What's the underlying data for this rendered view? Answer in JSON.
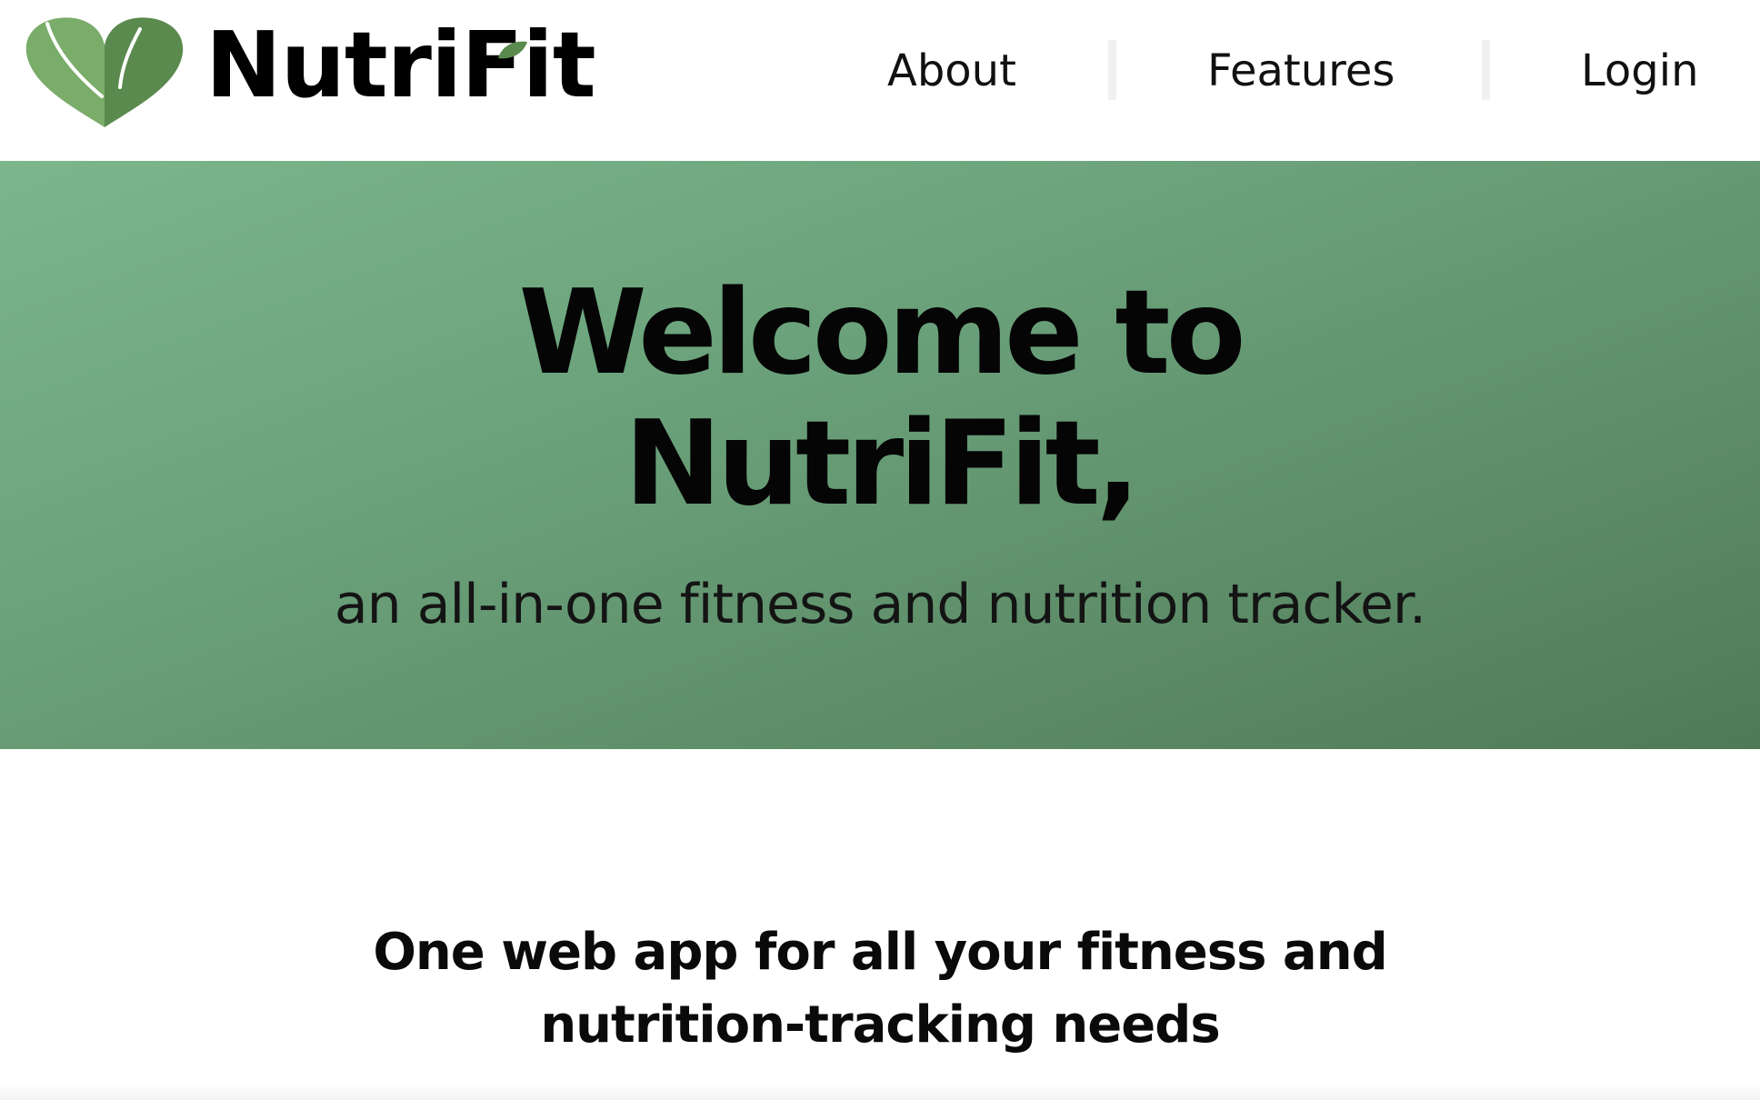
{
  "header": {
    "brand": {
      "name": "NutriFit",
      "logo_icon": "heart-leaf-icon"
    },
    "nav": [
      {
        "label": "About",
        "name": "nav-about-link"
      },
      {
        "label": "Features",
        "name": "nav-features-link"
      },
      {
        "label": "Login",
        "name": "nav-login-link"
      }
    ]
  },
  "hero": {
    "title_line1": "Welcome to",
    "title_line2": "NutriFit,",
    "subtitle": "an all-in-one fitness and nutrition tracker."
  },
  "section": {
    "tagline_line1": "One web app for all your fitness and",
    "tagline_line2": "nutrition-tracking needs"
  },
  "colors": {
    "brand_green": "#5e8e69",
    "brand_green_light": "#7bb68c",
    "brand_green_dark": "#4f7a58",
    "text": "#000000",
    "nav_divider": "#f1f1f1"
  }
}
